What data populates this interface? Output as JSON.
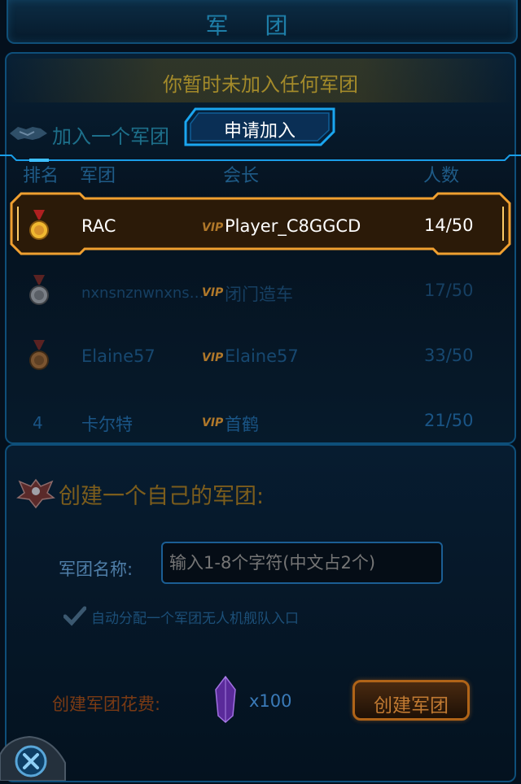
{
  "title": "军 团",
  "notice": "你暂时未加入任何军团",
  "join": {
    "label": "加入一个军团",
    "apply_button": "申请加入"
  },
  "table": {
    "headers": {
      "rank": "排名",
      "guild": "军团",
      "leader": "会长",
      "members": "人数"
    },
    "rows": [
      {
        "rank": "1",
        "rank_icon": "gold-medal-icon",
        "name": "RAC",
        "vip": "VIP",
        "leader": "Player_C8GGCD",
        "members": "14/50",
        "selected": true
      },
      {
        "rank": "2",
        "rank_icon": "silver-medal-icon",
        "name": "nxnsnznwnxns…",
        "vip": "VIP",
        "leader": "闭门造车",
        "members": "17/50",
        "selected": false
      },
      {
        "rank": "3",
        "rank_icon": "bronze-medal-icon",
        "name": "Elaine57",
        "vip": "VIP",
        "leader": "Elaine57",
        "members": "33/50",
        "selected": false
      },
      {
        "rank": "4",
        "rank_icon": "",
        "name": "卡尔特",
        "vip": "VIP",
        "leader": "首鹤",
        "members": "21/50",
        "selected": false
      }
    ]
  },
  "create": {
    "title": "创建一个自己的军团:",
    "name_label": "军团名称:",
    "name_placeholder": "输入1-8个字符(中文占2个)",
    "auto_assign": "自动分配一个军团无人机舰队入口",
    "auto_assign_checked": true,
    "cost_label": "创建军团花费:",
    "cost_icon": "purple-crystal-icon",
    "cost_value": "x100",
    "create_button": "创建军团"
  },
  "colors": {
    "gold": "#f0a030",
    "vip": "#b0782a",
    "dim_text": "#1f5b87",
    "panel_border": "#0e4f7a",
    "button_blue": "#19a7ef"
  },
  "icons": {
    "close": "close-icon",
    "handshake": "handshake-icon",
    "eagle": "eagle-emblem-icon"
  }
}
